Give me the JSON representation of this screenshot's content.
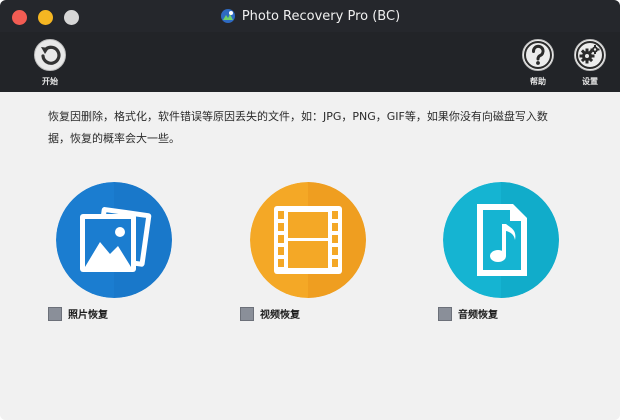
{
  "window": {
    "title": "Photo Recovery Pro (BC)"
  },
  "toolbar": {
    "start_label": "开始",
    "help_label": "帮助",
    "settings_label": "设置"
  },
  "main": {
    "description": "恢复因删除，格式化，软件错误等原因丢失的文件，如：JPG，PNG，GIF等，如果你没有向磁盘写入数据，恢复的概率会大一些。",
    "options": [
      {
        "label": "照片恢复",
        "icon": "photo-icon",
        "color": "#1a7ed0"
      },
      {
        "label": "视频恢复",
        "icon": "film-icon",
        "color": "#f2a627"
      },
      {
        "label": "音频恢复",
        "icon": "music-file-icon",
        "color": "#14b3d1"
      }
    ]
  },
  "colors": {
    "titlebar": "#25272c",
    "toolbar": "#222428",
    "background": "#f1f1f1"
  }
}
